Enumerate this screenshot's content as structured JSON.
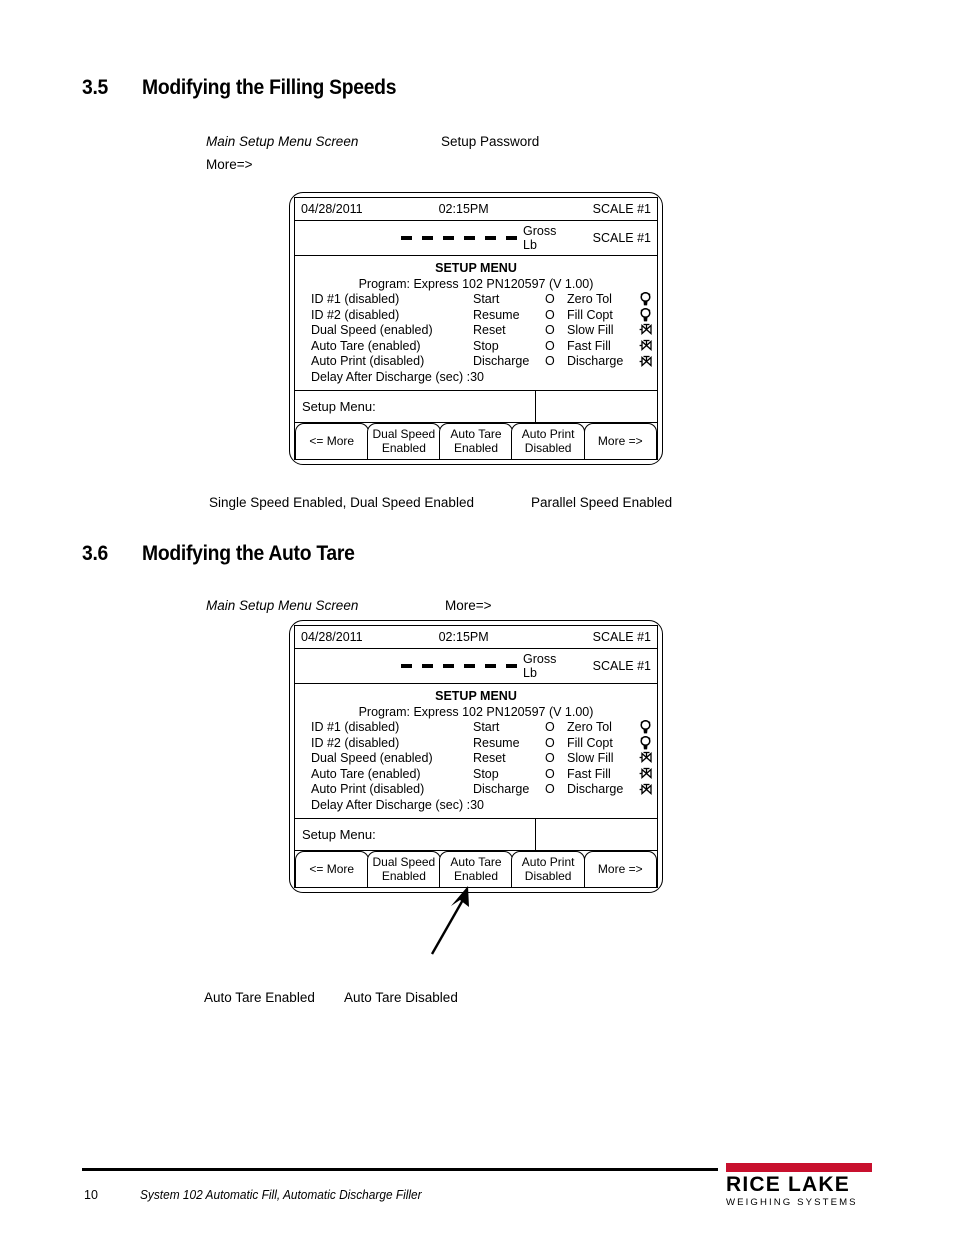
{
  "page": {
    "number": "10",
    "footer_title": "System 102 Automatic Fill, Automatic Discharge Filler",
    "logo": {
      "name": "RICE LAKE",
      "subtitle": "WEIGHING SYSTEMS",
      "accent_color": "#c8102e",
      "registered_mark": "®"
    }
  },
  "sections": [
    {
      "number": "3.5",
      "title": "Modifying the Filling Speeds",
      "intro_line1_a": "Main Setup Menu Screen",
      "intro_line1_b": "Setup Password",
      "intro_line2": "More=>",
      "caption_a": "Single Speed Enabled, Dual Speed Enabled",
      "caption_b": "Parallel Speed Enabled"
    },
    {
      "number": "3.6",
      "title": "Modifying the Auto Tare",
      "intro_line1_a": "Main Setup Menu Screen",
      "intro_line1_b": "More=>",
      "caption_a": "Auto Tare Enabled",
      "caption_b": "Auto Tare Disabled"
    }
  ],
  "display": {
    "date": "04/28/2011",
    "time": "02:15PM",
    "scale_top": "SCALE #1",
    "scale_weight": "SCALE #1",
    "weight_dashes": 6,
    "weight_mode": "Gross",
    "weight_unit": "Lb",
    "menu_title": "SETUP MENU",
    "program_line": "Program: Express 102 PN120597 (V 1.00)",
    "rows": [
      {
        "label": "ID #1 (disabled)",
        "command": "Start",
        "state": "O",
        "io": "Zero Tol",
        "icon": "light-bulb-icon"
      },
      {
        "label": "ID #2 (disabled)",
        "command": "Resume",
        "state": "O",
        "io": "Fill Copt",
        "icon": "light-bulb-icon"
      },
      {
        "label": "Dual Speed (enabled)",
        "command": "Reset",
        "state": "O",
        "io": "Slow Fill",
        "icon": "valve-icon"
      },
      {
        "label": "Auto Tare (enabled)",
        "command": "Stop",
        "state": "O",
        "io": "Fast Fill",
        "icon": "valve-icon"
      },
      {
        "label": "Auto Print (disabled)",
        "command": "Discharge",
        "state": "O",
        "io": "Discharge",
        "icon": "valve-icon"
      }
    ],
    "delay_line": "Delay After Discharge (sec) :30",
    "prompt_label": "Setup Menu:",
    "prompt_value": "",
    "buttons": [
      {
        "line1": "<= More",
        "line2": ""
      },
      {
        "line1": "Dual Speed",
        "line2": "Enabled"
      },
      {
        "line1": "Auto Tare",
        "line2": "Enabled"
      },
      {
        "line1": "Auto Print",
        "line2": "Disabled"
      },
      {
        "line1": "More =>",
        "line2": ""
      }
    ]
  }
}
